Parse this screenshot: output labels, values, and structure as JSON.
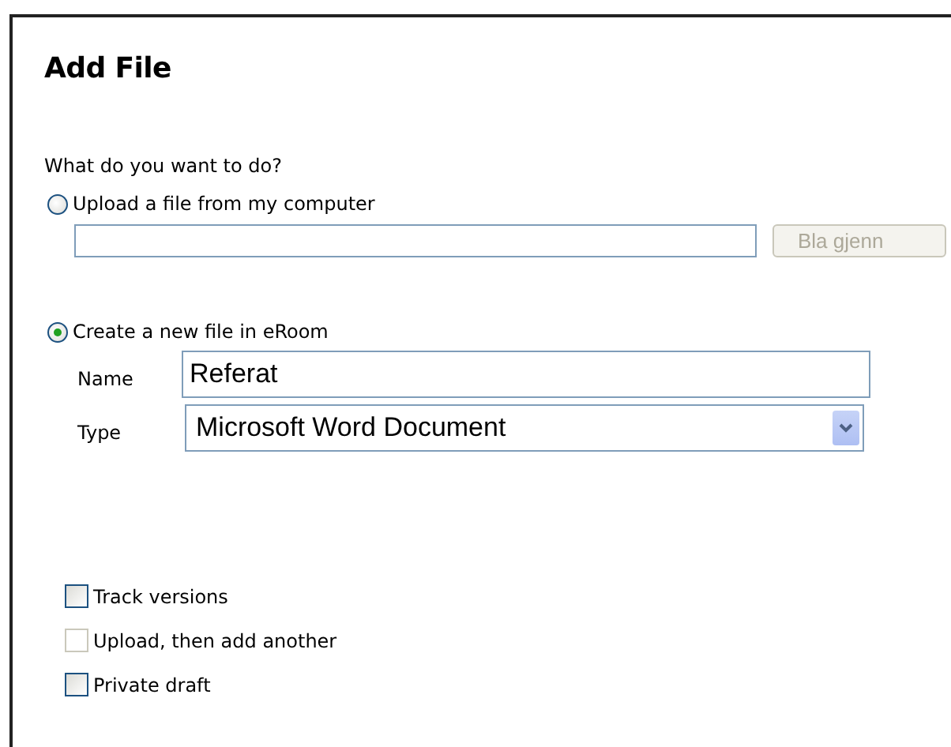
{
  "title": "Add File",
  "question": "What do you want to do?",
  "options": [
    {
      "kind": "upload",
      "label": "Upload a file from my computer",
      "selected": false,
      "browse_label": "Bla gjenn"
    },
    {
      "kind": "create",
      "label": "Create a new file in eRoom",
      "selected": true,
      "name_label": "Name",
      "name_value": "Referat",
      "type_label": "Type",
      "type_value": "Microsoft Word Document"
    }
  ],
  "checkboxes": [
    {
      "label": "Track versions",
      "checked": false,
      "disabled": false
    },
    {
      "label": "Upload, then add another",
      "checked": false,
      "disabled": true
    },
    {
      "label": "Private draft",
      "checked": false,
      "disabled": false
    }
  ]
}
